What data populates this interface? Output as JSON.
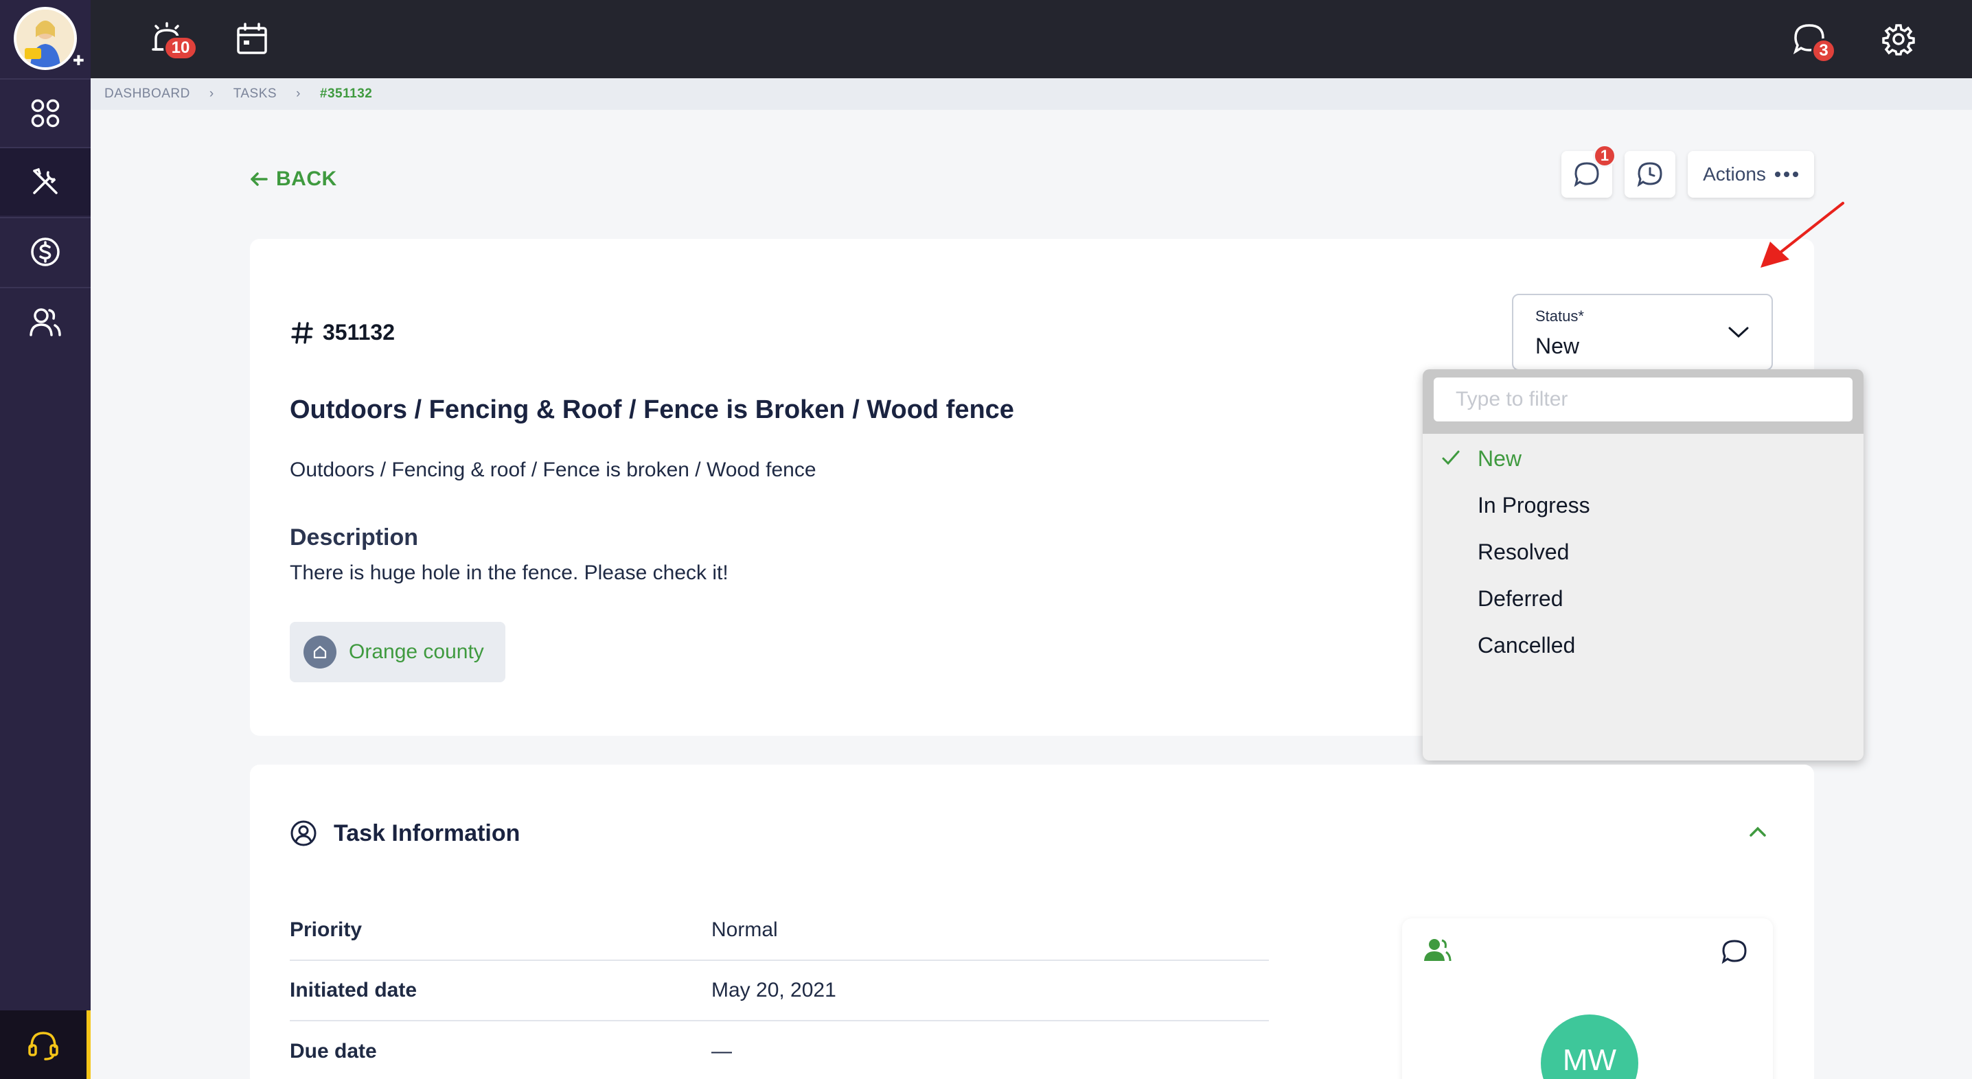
{
  "topbar": {
    "alarm_badge": "10",
    "chat_badge": "3"
  },
  "breadcrumb": {
    "items": [
      "DASHBOARD",
      "TASKS"
    ],
    "current": "#351132"
  },
  "header": {
    "back_label": "BACK",
    "comments_badge": "1",
    "actions_label": "Actions"
  },
  "task": {
    "number": "351132",
    "title": "Outdoors / Fencing & Roof / Fence is Broken / Wood fence",
    "category_path": "Outdoors / Fencing & roof / Fence is broken / Wood fence",
    "description_label": "Description",
    "description": "There is huge hole in the fence. Please check it!",
    "location": "Orange county"
  },
  "status": {
    "label": "Status*",
    "value": "New",
    "filter_placeholder": "Type to filter",
    "options": [
      "New",
      "In Progress",
      "Resolved",
      "Deferred",
      "Cancelled"
    ],
    "selected": "New"
  },
  "task_info": {
    "title": "Task Information",
    "rows": [
      {
        "key": "Priority",
        "value": "Normal"
      },
      {
        "key": "Initiated date",
        "value": "May 20, 2021"
      },
      {
        "key": "Due date",
        "value": "—"
      }
    ]
  },
  "assignee": {
    "initials": "MW"
  },
  "colors": {
    "accent": "#3f9a3f",
    "sidebar": "#2a2442",
    "topbar": "#24252e",
    "badge": "#e0413b",
    "avatar": "#3ec79a"
  }
}
